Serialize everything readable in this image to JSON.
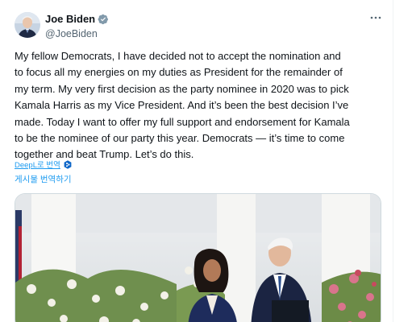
{
  "author": {
    "display_name": "Joe Biden",
    "handle": "@JoeBiden"
  },
  "icons": {
    "verified": "verified-badge-icon",
    "more": "more-options-icon",
    "deepl": "deepl-logo-icon"
  },
  "tweet": {
    "text": "My fellow Democrats, I have decided not to accept the nomination and\nto focus all my energies on my duties as President for the remainder of\nmy term. My very first decision as the party nominee in 2020 was to pick\nKamala Harris as my Vice President. And it’s been the best decision I’ve\nmade. Today I want to offer my full support and endorsement for Kamala\nto be the nominee of our party this year. Democrats — it’s time to come\ntogether and beat Trump. Let’s do this."
  },
  "translation": {
    "deepl_label": "DeepL로 번역",
    "translate_label": "게시물 번역하기"
  },
  "colors": {
    "accent": "#1d9bf0",
    "text": "#0f1419",
    "secondary": "#536471"
  }
}
